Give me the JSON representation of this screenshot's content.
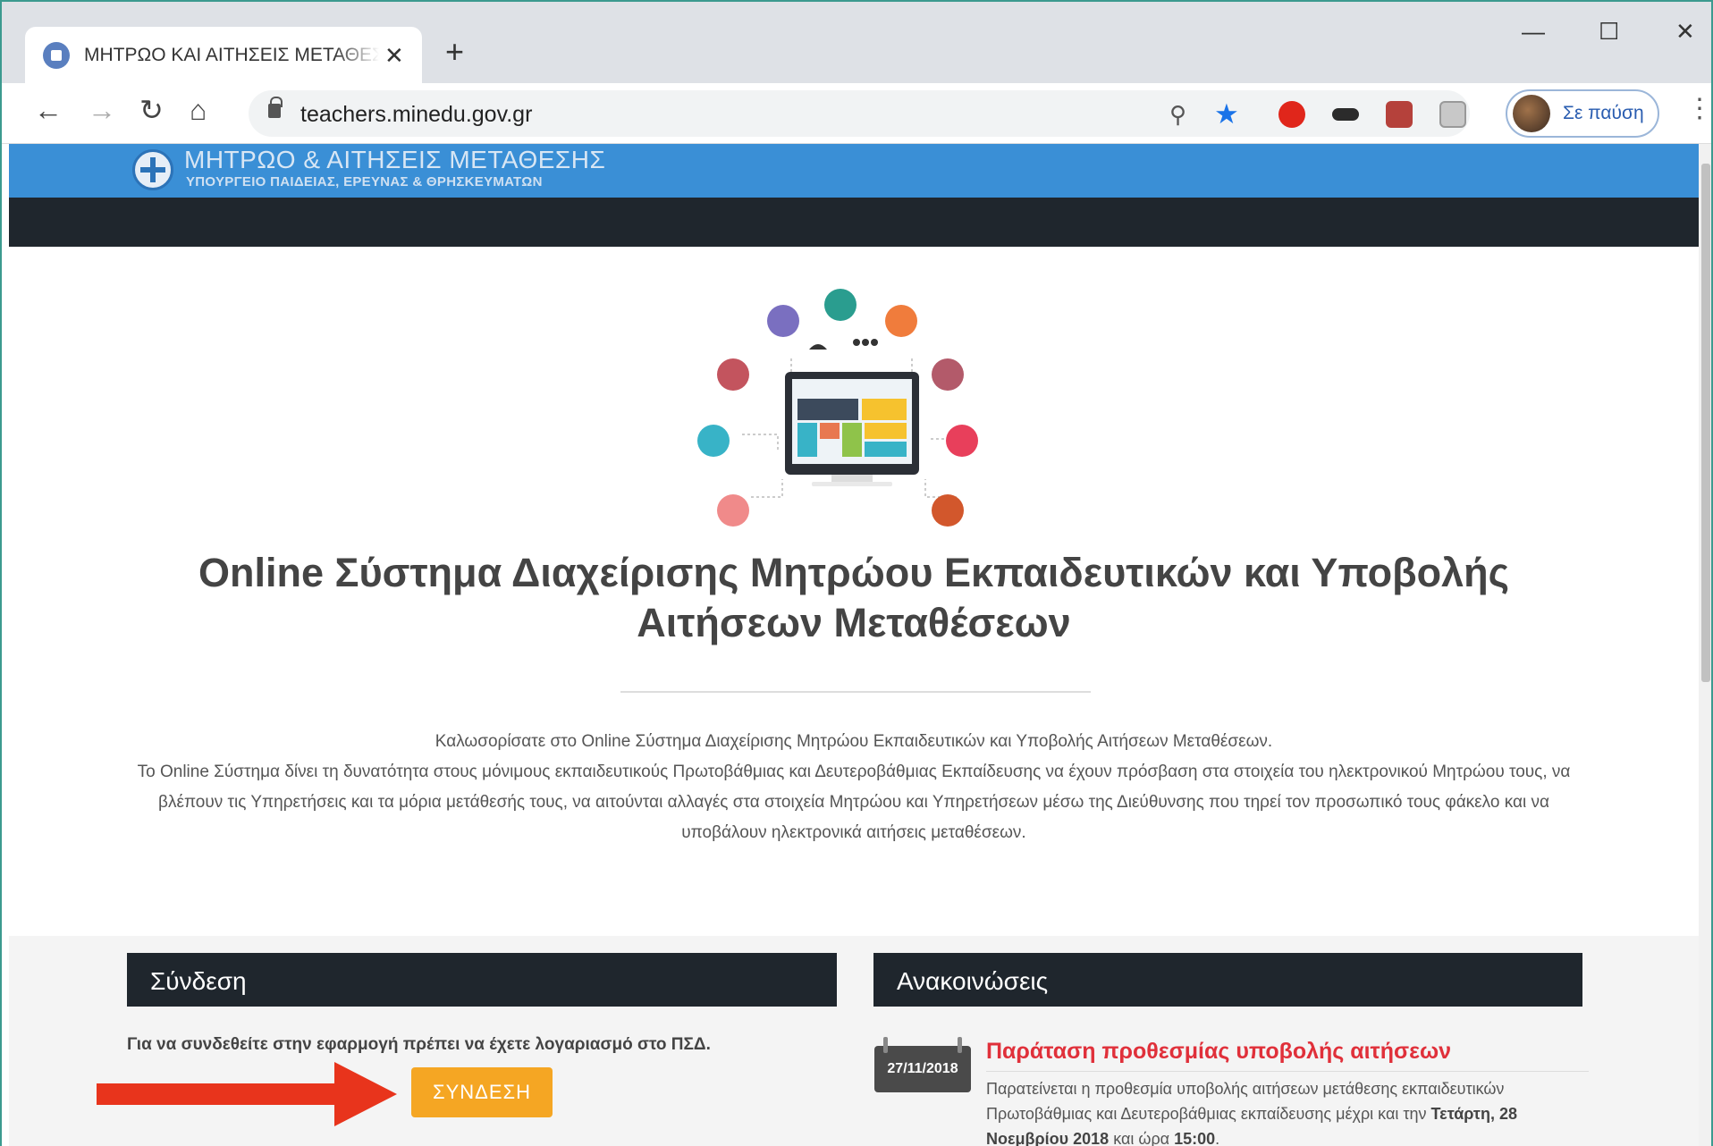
{
  "browser": {
    "tab_title": "ΜΗΤΡΩΟ ΚΑΙ ΑΙΤΗΣΕΙΣ ΜΕΤΑΘΕΣΗΣ",
    "tab_close": "✕",
    "new_tab": "+",
    "url": "teachers.minedu.gov.gr",
    "profile_label": "Σε παύση",
    "window_controls": {
      "minimize": "—",
      "maximize": "☐",
      "close": "✕"
    }
  },
  "site": {
    "title": "ΜΗΤΡΩΟ & ΑΙΤΗΣΕΙΣ ΜΕΤΑΘΕΣΗΣ",
    "subtitle": "ΥΠΟΥΡΓΕΙΟ ΠΑΙΔΕΙΑΣ, ΕΡΕΥΝΑΣ & ΘΡΗΣΚΕΥΜΑΤΩΝ"
  },
  "main": {
    "title_line1": "Online Σύστημα Διαχείρισης Μητρώου Εκπαιδευτικών και Υποβολής",
    "title_line2": "Αιτήσεων Μεταθέσεων",
    "intro_line1": "Καλωσορίσατε στο Online Σύστημα Διαχείρισης Μητρώου Εκπαιδευτικών και Υποβολής Αιτήσεων Μεταθέσεων.",
    "intro_line2": "Το Online Σύστημα δίνει τη δυνατότητα στους μόνιμους εκπαιδευτικούς Πρωτοβάθμιας και Δευτεροβάθμιας Εκπαίδευσης να έχουν πρόσβαση στα στοιχεία του ηλεκτρονικού Μητρώου τους, να βλέπουν τις Υπηρετήσεις και τα μόρια μετάθεσής τους, να αιτούνται αλλαγές στα στοιχεία Μητρώου και Υπηρετήσεων μέσω της Διεύθυνσης που τηρεί τον προσωπικό τους φάκελο και να υποβάλουν ηλεκτρονικά αιτήσεις μεταθέσεων."
  },
  "login": {
    "heading": "Σύνδεση",
    "text": "Για να συνδεθείτε στην εφαρμογή πρέπει να έχετε λογαριασμό στο ΠΣΔ.",
    "button": "ΣΥΝΔΕΣΗ"
  },
  "announcements": {
    "heading": "Ανακοινώσεις",
    "items": [
      {
        "date": "27/11/2018",
        "title": "Παράταση προθεσμίας υποβολής αιτήσεων",
        "body_prefix": "Παρατείνεται η προθεσμία υποβολής αιτήσεων μετάθεσης εκπαιδευτικών Πρωτοβάθμιας και Δευτεροβάθμιας εκπαίδευσης μέχρι και την ",
        "body_bold_date": "Τετάρτη, 28 Νοεμβρίου 2018",
        "body_mid": " και ώρα ",
        "body_bold_time": "15:00",
        "body_suffix": "."
      }
    ]
  },
  "colors": {
    "header_blue": "#3a8fd6",
    "nav_dark": "#1f262d",
    "button_orange": "#f5a623",
    "announcement_red": "#e0303a",
    "arrow_red": "#e8341c"
  },
  "icons": [
    "tab-favicon-icon",
    "back-icon",
    "forward-icon",
    "reload-icon",
    "home-icon",
    "lock-icon",
    "zoom-icon",
    "star-icon",
    "menu-dots-icon",
    "arrow-pointer-icon"
  ]
}
